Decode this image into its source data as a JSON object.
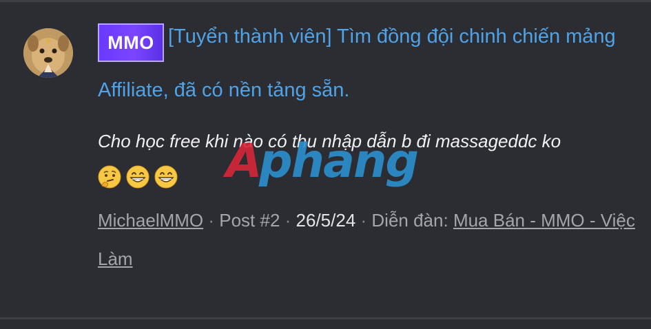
{
  "post": {
    "prefix": "MMO",
    "title": "[Tuyển thành viên] Tìm đồng đội chinh chiến mảng Affiliate, đã có nền tảng sẵn.",
    "snippet": "Cho học free khi nào có thu nhập dẫn b đi massageddc ko",
    "emojis": [
      "thinking-face-emoji",
      "grinning-face-emoji",
      "grinning-face-emoji"
    ]
  },
  "meta": {
    "author": "MichaelMMO",
    "separator": " · ",
    "post_number": "Post #2",
    "date": "26/5/24",
    "forum_label": "Diễn đàn:",
    "forum_name": "Mua Bán - MMO - Việc Làm"
  },
  "watermark": {
    "first": "A",
    "rest": "phang"
  },
  "colors": {
    "background": "#2c2d33",
    "link_blue": "#4fa3e6",
    "prefix_purple": "#6a38ff",
    "meta_gray": "#a4a5ad",
    "watermark_red": "#d6273a",
    "watermark_blue": "#2b8fcf"
  }
}
